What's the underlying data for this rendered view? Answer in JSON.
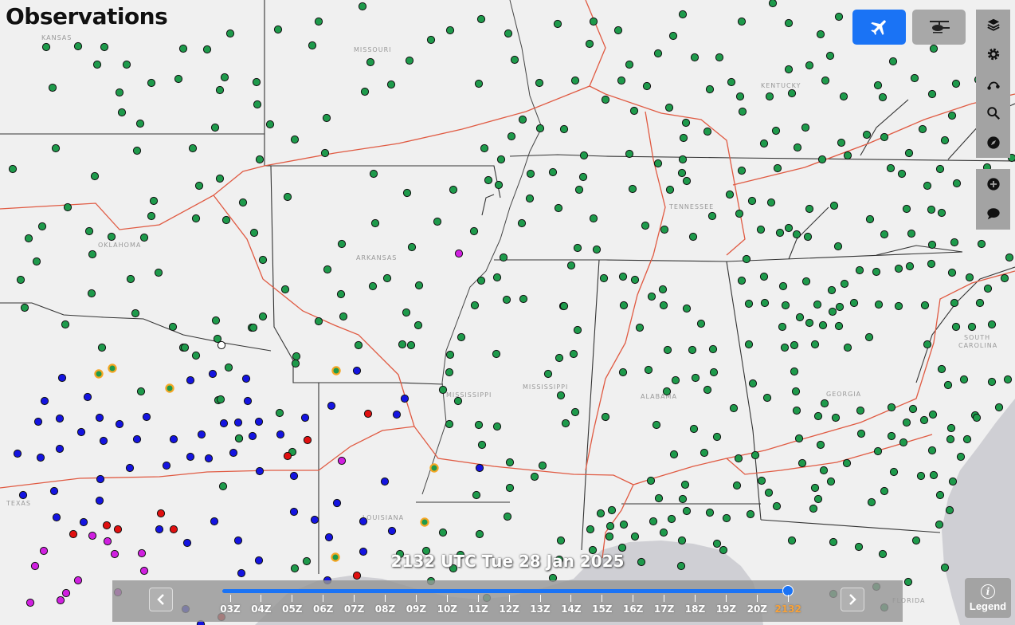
{
  "title": "Observations",
  "timestamp": "2132 UTC Tue 28 Jan 2025",
  "state_labels": [
    "KANSAS",
    "MISSOURI",
    "KENTUCKY",
    "OKLAHOMA",
    "ARKANSAS",
    "TENNESSEE",
    "MISSISSIPPI",
    "MISSISSIPPI",
    "ALABAMA",
    "GEORGIA",
    "SOUTH",
    "CAROLINA",
    "TEXAS",
    "LOUISIANA",
    "FLORIDA"
  ],
  "time_ticks": [
    "03Z",
    "04Z",
    "05Z",
    "06Z",
    "07Z",
    "08Z",
    "09Z",
    "10Z",
    "11Z",
    "12Z",
    "13Z",
    "14Z",
    "15Z",
    "16Z",
    "17Z",
    "18Z",
    "19Z",
    "20Z",
    "2132"
  ],
  "legend_label": "Legend",
  "colors": {
    "vfr": "#1e9a4b",
    "mvfr": "#1414e0",
    "ifr": "#e01010",
    "lifr": "#d020e0",
    "accent": "#1a73f5",
    "current_time": "#f7a23a"
  },
  "icons": {
    "plane_mode": "airplane-icon",
    "heli_mode": "helicopter-icon",
    "layers": "layers-icon",
    "settings": "gear-icon",
    "route": "route-icon",
    "search": "search-icon",
    "compass": "compass-icon",
    "zoom_in": "zoom-in-icon",
    "comment": "comment-icon",
    "prev": "chevron-left-icon",
    "next": "chevron-right-icon",
    "info": "info-icon"
  }
}
